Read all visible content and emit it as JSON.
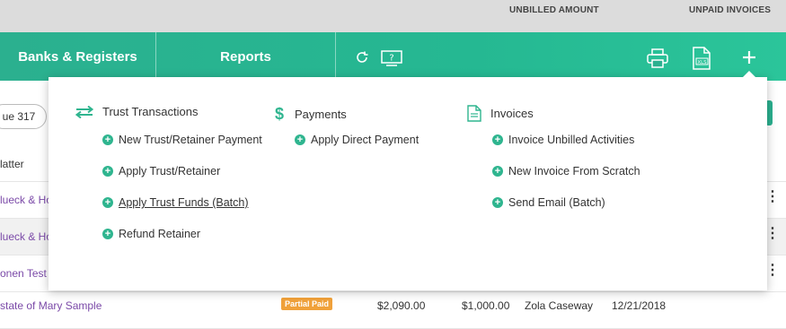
{
  "header_columns": {
    "unbilled": "UNBILLED AMOUNT",
    "unpaid": "UNPAID INVOICES"
  },
  "nav": {
    "banks": "Banks & Registers",
    "reports": "Reports"
  },
  "background": {
    "issue_pill": "ue 317",
    "col_matter": "latter",
    "rows": [
      "lueck & Ho",
      "lueck & Ho",
      "onen Test"
    ],
    "last_row": {
      "matter": "state of Mary Sample",
      "badge": "Partial Paid",
      "amount1": "$2,090.00",
      "amount2": "$1,000.00",
      "person": "Zola Caseway",
      "date": "12/21/2018"
    }
  },
  "menu": {
    "trust": {
      "title": "Trust Transactions",
      "items": [
        "New Trust/Retainer Payment",
        "Apply Trust/Retainer",
        "Apply Trust Funds (Batch)",
        "Refund Retainer"
      ]
    },
    "payments": {
      "title": "Payments",
      "items": [
        "Apply Direct Payment"
      ]
    },
    "invoices": {
      "title": "Invoices",
      "items": [
        "Invoice Unbilled Activities",
        "New Invoice From Scratch",
        "Send Email (Batch)"
      ]
    }
  },
  "colors": {
    "accent": "#2bb08f",
    "plus": "#2fb58f",
    "badge": "#f0a13a"
  }
}
